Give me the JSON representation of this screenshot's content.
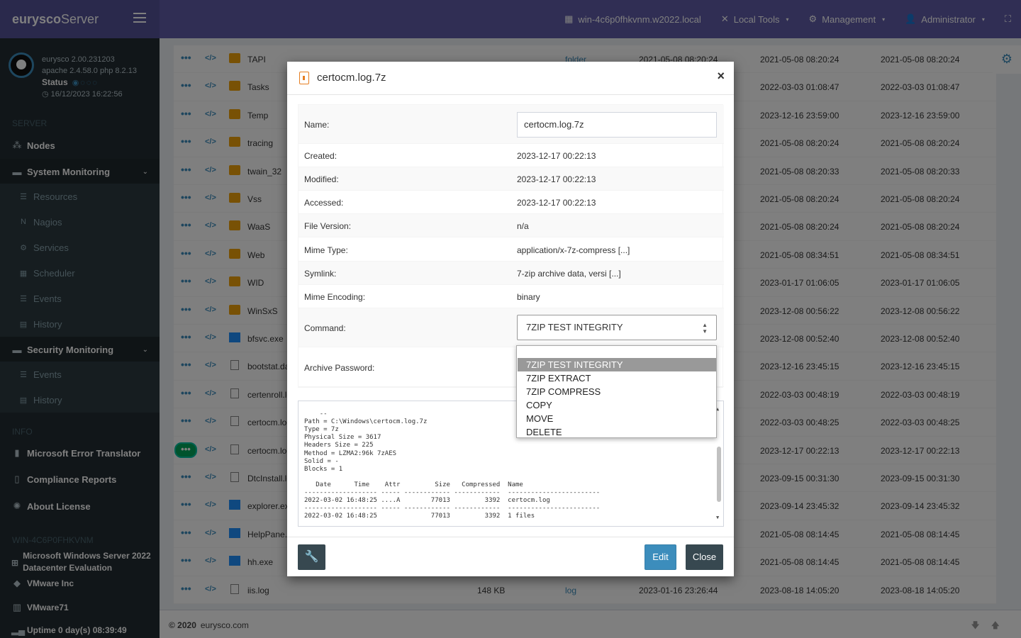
{
  "brand": {
    "bold": "eurysco",
    "light": "Server"
  },
  "topnav": [
    {
      "icon": "server-icon",
      "label": "win-4c6p0fhkvnm.w2022.local"
    },
    {
      "icon": "tools-icon",
      "label": "Local Tools"
    },
    {
      "icon": "gears-icon",
      "label": "Management"
    },
    {
      "icon": "user-icon",
      "label": "Administrator"
    }
  ],
  "sidebar": {
    "version": "eurysco 2.00.231203",
    "stack": "apache 2.4.58.0 php 8.2.13",
    "status_label": "Status",
    "datetime": "16/12/2023 16:22:56",
    "header_server": "SERVER",
    "nodes": "Nodes",
    "system_monitoring": "System Monitoring",
    "sys_items": [
      "Resources",
      "Nagios",
      "Services",
      "Scheduler",
      "Events",
      "History"
    ],
    "security_monitoring": "Security Monitoring",
    "sec_items": [
      "Events",
      "History"
    ],
    "header_info": "INFO",
    "error_translator": "Microsoft Error Translator",
    "compliance": "Compliance Reports",
    "license": "About License",
    "header_host": "WIN-4C6P0FHKVNM",
    "os": "Microsoft Windows Server 2022 Datacenter Evaluation",
    "vendor": "VMware Inc",
    "model": "VMware71",
    "uptime": "Uptime 0 day(s) 08:39:49"
  },
  "files": [
    {
      "name": "TAPI",
      "icon": "folder",
      "type": "folder",
      "d1": "2021-05-08 08:20:24",
      "d2": "2021-05-08 08:20:24",
      "d3": "2021-05-08 08:20:24",
      "size": ""
    },
    {
      "name": "Tasks",
      "icon": "folder",
      "type": "",
      "d1": "",
      "d2": "2022-03-03 01:08:47",
      "d3": "2022-03-03 01:08:47",
      "size": ""
    },
    {
      "name": "Temp",
      "icon": "folder",
      "type": "",
      "d1": "",
      "d2": "2023-12-16 23:59:00",
      "d3": "2023-12-16 23:59:00",
      "size": ""
    },
    {
      "name": "tracing",
      "icon": "folder",
      "type": "",
      "d1": "",
      "d2": "2021-05-08 08:20:24",
      "d3": "2021-05-08 08:20:24",
      "size": ""
    },
    {
      "name": "twain_32",
      "icon": "folder",
      "type": "",
      "d1": "",
      "d2": "2021-05-08 08:20:33",
      "d3": "2021-05-08 08:20:33",
      "size": ""
    },
    {
      "name": "Vss",
      "icon": "folder",
      "type": "",
      "d1": "",
      "d2": "2021-05-08 08:20:24",
      "d3": "2021-05-08 08:20:24",
      "size": ""
    },
    {
      "name": "WaaS",
      "icon": "folder",
      "type": "",
      "d1": "",
      "d2": "2021-05-08 08:20:24",
      "d3": "2021-05-08 08:20:24",
      "size": ""
    },
    {
      "name": "Web",
      "icon": "folder",
      "type": "",
      "d1": "",
      "d2": "2021-05-08 08:34:51",
      "d3": "2021-05-08 08:34:51",
      "size": ""
    },
    {
      "name": "WID",
      "icon": "folder",
      "type": "",
      "d1": "",
      "d2": "2023-01-17 01:06:05",
      "d3": "2023-01-17 01:06:05",
      "size": ""
    },
    {
      "name": "WinSxS",
      "icon": "folder",
      "type": "",
      "d1": "",
      "d2": "2023-12-08 00:56:22",
      "d3": "2023-12-08 00:56:22",
      "size": ""
    },
    {
      "name": "bfsvc.exe",
      "icon": "win",
      "type": "",
      "d1": "",
      "d2": "2023-12-08 00:52:40",
      "d3": "2023-12-08 00:52:40",
      "size": ""
    },
    {
      "name": "bootstat.dat",
      "icon": "doc",
      "type": "",
      "d1": "",
      "d2": "2023-12-16 23:45:15",
      "d3": "2023-12-16 23:45:15",
      "size": ""
    },
    {
      "name": "certenroll.log",
      "icon": "doc",
      "type": "",
      "d1": "",
      "d2": "2022-03-03 00:48:19",
      "d3": "2022-03-03 00:48:19",
      "size": ""
    },
    {
      "name": "certocm.log",
      "icon": "doc",
      "type": "",
      "d1": "",
      "d2": "2022-03-03 00:48:25",
      "d3": "2022-03-03 00:48:25",
      "size": ""
    },
    {
      "name": "certocm.log.7z",
      "icon": "doc",
      "type": "",
      "d1": "",
      "d2": "2023-12-17 00:22:13",
      "d3": "2023-12-17 00:22:13",
      "size": "",
      "selected": true
    },
    {
      "name": "DtcInstall.log",
      "icon": "doc",
      "type": "",
      "d1": "",
      "d2": "2023-09-15 00:31:30",
      "d3": "2023-09-15 00:31:30",
      "size": ""
    },
    {
      "name": "explorer.exe",
      "icon": "win",
      "type": "",
      "d1": "",
      "d2": "2023-09-14 23:45:32",
      "d3": "2023-09-14 23:45:32",
      "size": ""
    },
    {
      "name": "HelpPane.exe",
      "icon": "win",
      "type": "",
      "d1": "",
      "d2": "2021-05-08 08:14:45",
      "d3": "2021-05-08 08:14:45",
      "size": ""
    },
    {
      "name": "hh.exe",
      "icon": "win",
      "type": "",
      "d1": "",
      "d2": "2021-05-08 08:14:45",
      "d3": "2021-05-08 08:14:45",
      "size": ""
    },
    {
      "name": "iis.log",
      "icon": "doc",
      "type": "log",
      "d1": "2023-01-16 23:26:44",
      "d2": "2023-08-18 14:05:20",
      "d3": "2023-08-18 14:05:20",
      "size": "148 KB"
    }
  ],
  "footer": {
    "copyright": "© 2020",
    "site": "eurysco.com"
  },
  "modal": {
    "title": "certocm.log.7z",
    "name_label": "Name:",
    "name_value": "certocm.log.7z",
    "props": [
      {
        "label": "Created:",
        "value": "2023-12-17 00:22:13"
      },
      {
        "label": "Modified:",
        "value": "2023-12-17 00:22:13"
      },
      {
        "label": "Accessed:",
        "value": "2023-12-17 00:22:13"
      },
      {
        "label": "File Version:",
        "value": "n/a"
      },
      {
        "label": "Mime Type:",
        "value": "application/x-7z-compress [...]"
      },
      {
        "label": "Symlink:",
        "value": "7-zip archive data, versi [...]"
      },
      {
        "label": "Mime Encoding:",
        "value": "binary"
      }
    ],
    "command_label": "Command:",
    "command_value": "7ZIP TEST INTEGRITY",
    "password_label": "Archive Password:",
    "output": "--\nPath = C:\\Windows\\certocm.log.7z\nType = 7z\nPhysical Size = 3617\nHeaders Size = 225\nMethod = LZMA2:96k 7zAES\nSolid = -\nBlocks = 1\n\n   Date      Time    Attr         Size   Compressed  Name\n------------------- ----- ------------ ------------  ------------------------\n2022-03-02 16:48:25 ....A        77013         3392  certocm.log\n------------------- ----- ------------ ------------  ------------------------\n2022-03-02 16:48:25              77013         3392  1 files",
    "edit_label": "Edit",
    "close_label": "Close",
    "close_x": "×"
  },
  "dropdown": {
    "options": [
      "7ZIP TEST INTEGRITY",
      "7ZIP EXTRACT",
      "7ZIP COMPRESS",
      "COPY",
      "MOVE",
      "DELETE"
    ],
    "highlighted": "7ZIP TEST INTEGRITY"
  },
  "colors": {
    "header": "#605ca8",
    "sidebar": "#222d32",
    "primary": "#3c8dbc",
    "dark_button": "#374850"
  }
}
